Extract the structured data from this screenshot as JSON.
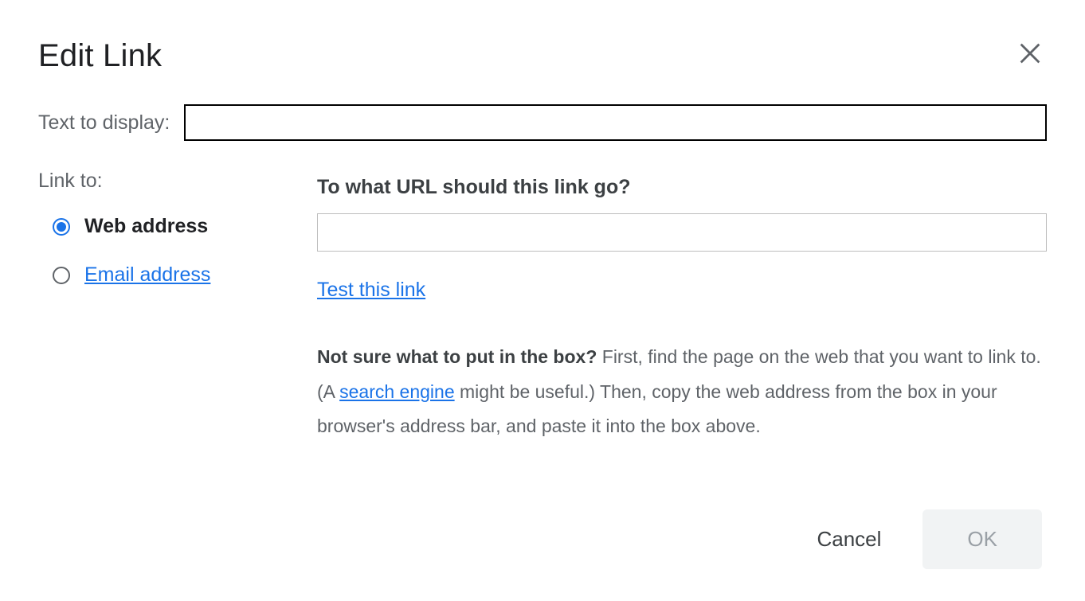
{
  "dialog": {
    "title": "Edit Link",
    "text_to_display_label": "Text to display:",
    "text_to_display_value": "",
    "link_to_label": "Link to:",
    "options": {
      "web_address": "Web address",
      "email_address": "Email address"
    },
    "selected_option": "web_address",
    "url_section": {
      "label": "To what URL should this link go?",
      "value": "",
      "test_link": "Test this link"
    },
    "help": {
      "bold_prefix": "Not sure what to put in the box?",
      "text_before_link": " First, find the page on the web that you want to link to. (A ",
      "search_engine": "search engine",
      "text_after_link": " might be useful.) Then, copy the web address from the box in your browser's address bar, and paste it into the box above."
    },
    "buttons": {
      "cancel": "Cancel",
      "ok": "OK"
    }
  }
}
